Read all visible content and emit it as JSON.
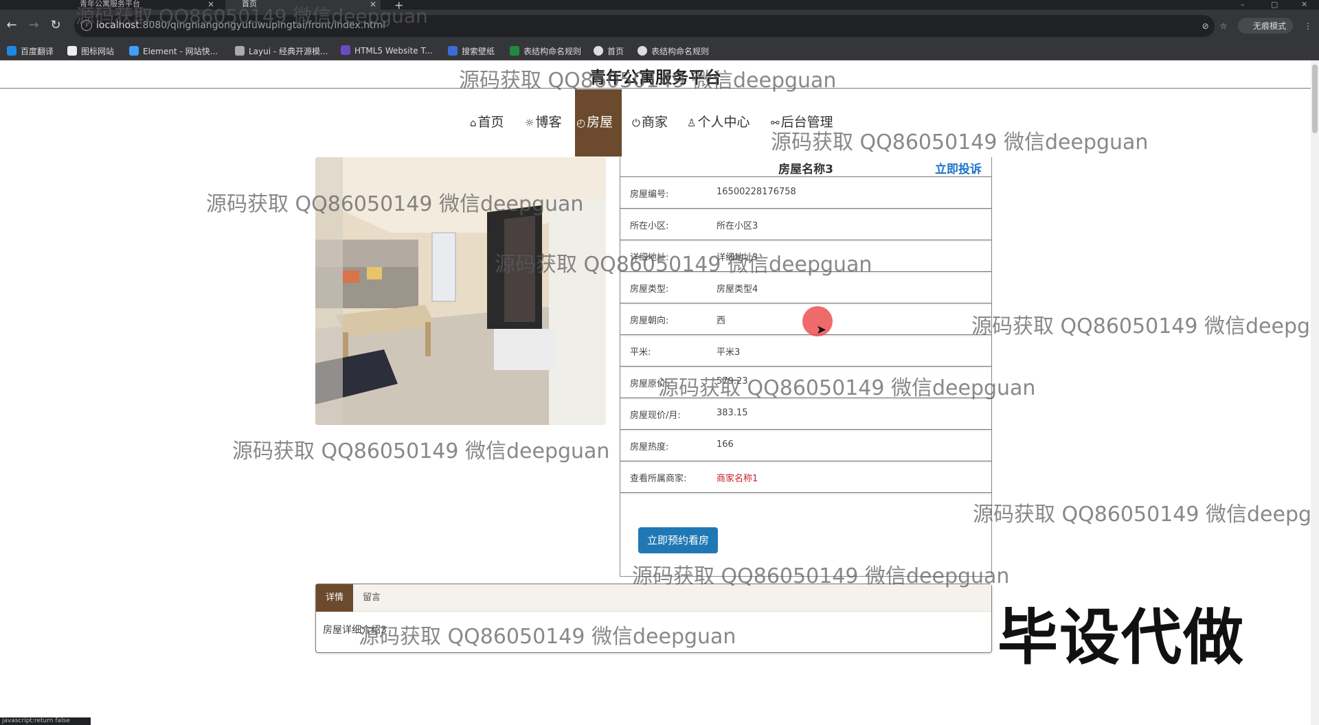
{
  "browser": {
    "tabs": [
      {
        "label": "青年公寓服务平台"
      },
      {
        "label": "首页"
      }
    ],
    "url_host": "localhost",
    "url_path": ":8080/qingniangongyufuwupingtai/front/index.html",
    "incognito": "无痕模式",
    "bookmarks": [
      {
        "label": "百度翻译",
        "color": "#1e88e5"
      },
      {
        "label": "图标网站",
        "color": "#eeeeee"
      },
      {
        "label": "Element - 网站快...",
        "color": "#409eff"
      },
      {
        "label": "Layui - 经典开源模...",
        "color": "#aaaaaa"
      },
      {
        "label": "HTML5 Website T...",
        "color": "#6a4bc4"
      },
      {
        "label": "搜索壁纸",
        "color": "#3b6bd6"
      },
      {
        "label": "表结构命名规则",
        "color": "#1f8a3d"
      },
      {
        "label": "首页",
        "color": "#dddddd"
      },
      {
        "label": "表结构命名规则",
        "color": "#dddddd"
      }
    ],
    "status": "javascript:return false"
  },
  "site": {
    "title": "青年公寓服务平台",
    "nav": [
      {
        "label": "首页",
        "icon": "home-icon",
        "glyph": "⌂"
      },
      {
        "label": "博客",
        "icon": "gear-icon",
        "glyph": "☼"
      },
      {
        "label": "房屋",
        "icon": "house-icon",
        "glyph": "◴"
      },
      {
        "label": "商家",
        "icon": "power-icon",
        "glyph": "⏻"
      },
      {
        "label": "个人中心",
        "icon": "user-icon",
        "glyph": "♙"
      },
      {
        "label": "后台管理",
        "icon": "link-icon",
        "glyph": "⚯"
      }
    ]
  },
  "house": {
    "name": "房屋名称3",
    "complain": "立即投诉",
    "fields": [
      {
        "label": "房屋编号:",
        "value": "16500228176758"
      },
      {
        "label": "所在小区:",
        "value": "所在小区3"
      },
      {
        "label": "详细地址:",
        "value": "详细地址3"
      },
      {
        "label": "房屋类型:",
        "value": "房屋类型4"
      },
      {
        "label": "房屋朝向:",
        "value": "西"
      },
      {
        "label": "平米:",
        "value": "平米3"
      },
      {
        "label": "房屋原价:",
        "value": "579.23"
      },
      {
        "label": "房屋现价/月:",
        "value": "383.15"
      },
      {
        "label": "房屋热度:",
        "value": "166"
      },
      {
        "label": "查看所属商家:",
        "value": "商家名称1"
      }
    ],
    "book_button": "立即预约看房",
    "tabs": [
      {
        "label": "详情"
      },
      {
        "label": "留言"
      }
    ],
    "detail": "房屋详细介绍3"
  },
  "overlay": {
    "watermark": "源码获取 QQ86050149 微信deepguan",
    "watermark_partial": "源码获取 QQ86050149 微信deepgua",
    "promo": "毕设代做"
  },
  "colors": {
    "accent": "#6b4a2d",
    "button": "#1f78b4",
    "link": "#1a73c8",
    "merchant": "#c8202a"
  }
}
